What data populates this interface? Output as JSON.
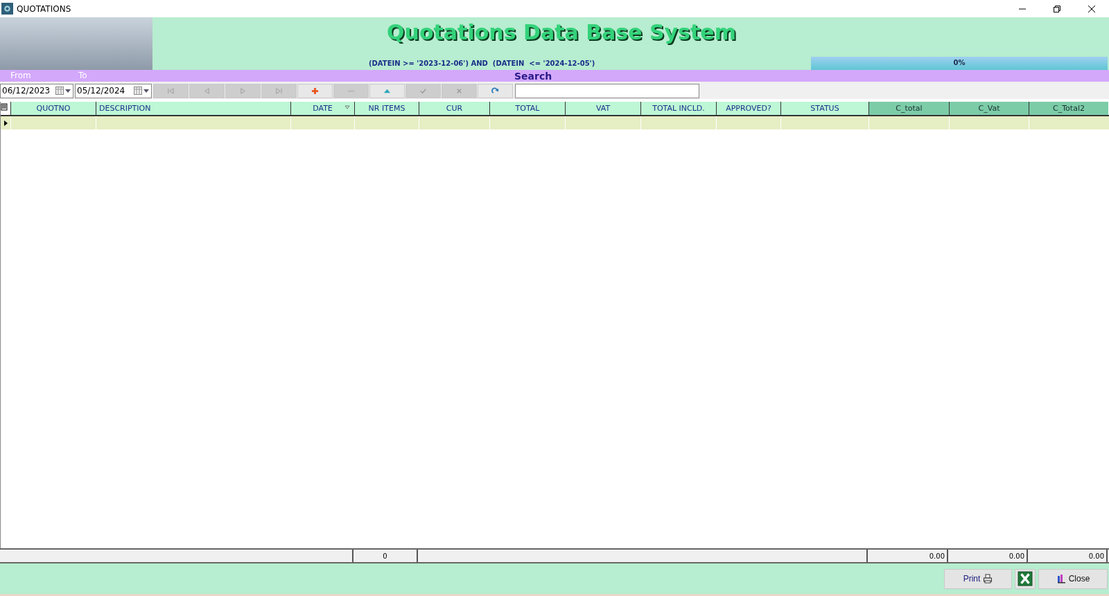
{
  "window": {
    "title": "QUOTATIONS"
  },
  "header": {
    "title": "Quotations Data Base System",
    "filter": "(DATEIN >= '2023-12-06') AND  (DATEIN  <= '2024-12-05')",
    "progress": {
      "level": 0,
      "reading": "0%"
    }
  },
  "search_bar": {
    "from_label": "From",
    "to_label": "To",
    "search_label": "Search"
  },
  "toolbar": {
    "from_date": "06/12/2023",
    "to_date": "05/12/2024",
    "buttons": [
      {
        "kind": "first",
        "disabled": true
      },
      {
        "kind": "prior",
        "disabled": true
      },
      {
        "kind": "next",
        "disabled": true
      },
      {
        "kind": "last",
        "disabled": true
      },
      {
        "kind": "insert",
        "disabled": false
      },
      {
        "kind": "delete",
        "disabled": true
      },
      {
        "kind": "edit",
        "disabled": false
      },
      {
        "kind": "post",
        "disabled": true
      },
      {
        "kind": "cancel",
        "disabled": true
      },
      {
        "kind": "refresh",
        "disabled": false
      }
    ]
  },
  "table": {
    "columns": [
      {
        "label": "QUOTNO",
        "kind": "field",
        "filtered": false
      },
      {
        "label": "DESCRIPTION",
        "kind": "field",
        "filtered": false
      },
      {
        "label": "DATE",
        "kind": "field",
        "filtered": true
      },
      {
        "label": "NR ITEMS",
        "kind": "field",
        "filtered": false
      },
      {
        "label": "CUR",
        "kind": "field",
        "filtered": false
      },
      {
        "label": "TOTAL",
        "kind": "field",
        "filtered": false
      },
      {
        "label": "VAT",
        "kind": "field",
        "filtered": false
      },
      {
        "label": "TOTAL INCLD.",
        "kind": "field",
        "filtered": false
      },
      {
        "label": "APPROVED?",
        "kind": "field",
        "filtered": false
      },
      {
        "label": "STATUS",
        "kind": "field",
        "filtered": false
      },
      {
        "label": "C_total",
        "kind": "computed",
        "filtered": false
      },
      {
        "label": "C_Vat",
        "kind": "computed",
        "filtered": false
      },
      {
        "label": "C_Total2",
        "kind": "computed",
        "filtered": false
      }
    ],
    "totals": {
      "nr_items": "0",
      "c_total": "0.00",
      "c_vat": "0.00",
      "c_total2": "0.00"
    }
  },
  "footer": {
    "print_label": "Print",
    "close_label": "Close"
  }
}
